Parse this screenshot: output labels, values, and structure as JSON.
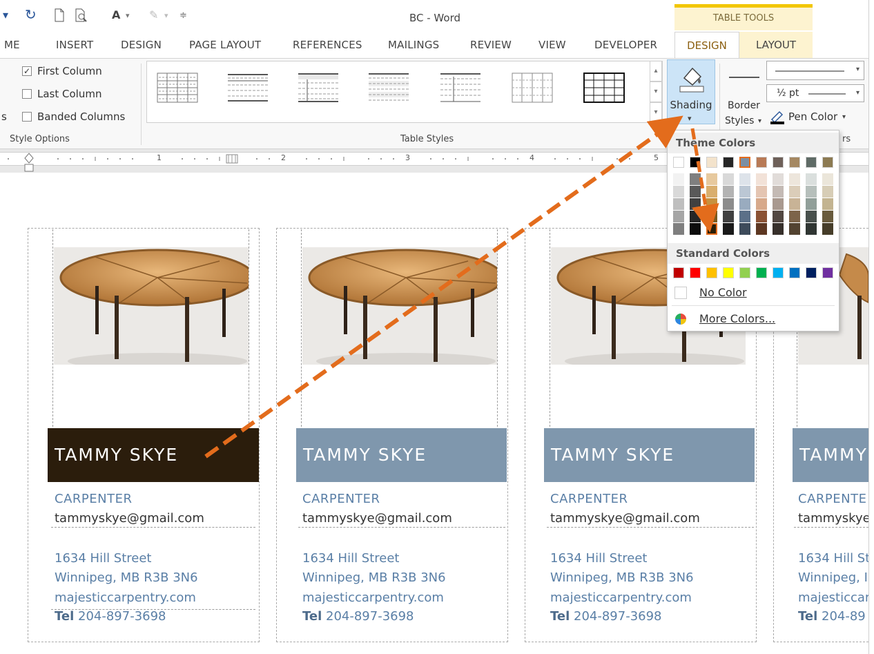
{
  "window": {
    "title": "BC - Word",
    "contextual_group": "TABLE TOOLS"
  },
  "tabs": [
    "ME",
    "INSERT",
    "DESIGN",
    "PAGE LAYOUT",
    "REFERENCES",
    "MAILINGS",
    "REVIEW",
    "VIEW",
    "DEVELOPER"
  ],
  "contextual_tabs": {
    "design": "DESIGN",
    "layout": "LAYOUT"
  },
  "style_options": {
    "first_column": "First Column",
    "last_column": "Last Column",
    "banded_columns": "Banded Columns",
    "group_label": "Style Options",
    "left_fragment": "s"
  },
  "table_styles": {
    "group_label": "Table Styles"
  },
  "shading": {
    "label": "Shading"
  },
  "borders": {
    "border_styles_line1": "Border",
    "border_styles_line2": "Styles",
    "pen_weight": "½ pt",
    "pen_color": "Pen Color",
    "group_fragment": "rs"
  },
  "ruler": {
    "numbers": [
      "1",
      "2",
      "3",
      "4",
      "5"
    ]
  },
  "shading_menu": {
    "theme_header": "Theme Colors",
    "standard_header": "Standard Colors",
    "no_color": "No Color",
    "more_colors": "More Colors...",
    "theme_top_row": [
      "#ffffff",
      "#000000",
      "#f3e3cc",
      "#262626",
      "#7b8fa3",
      "#b87a56",
      "#6e6059",
      "#a58862",
      "#5f6b66",
      "#8c7a52"
    ],
    "theme_tints": [
      [
        "#f2f2f2",
        "#7f7f7f",
        "#e7c99e",
        "#d9d9d9",
        "#dde3ea",
        "#f2e2d8",
        "#e1dcd9",
        "#ede6dc",
        "#dadfdd",
        "#ebe6da"
      ],
      [
        "#d9d9d9",
        "#595959",
        "#d9ae6d",
        "#b3b3b3",
        "#bbc7d4",
        "#e4c5b2",
        "#c4bab4",
        "#dbcdb9",
        "#b6bfbb",
        "#d7cdb6"
      ],
      [
        "#bfbfbf",
        "#404040",
        "#c7913f",
        "#8c8c8c",
        "#99abbf",
        "#d7a98b",
        "#a9998f",
        "#c8b396",
        "#919f99",
        "#c3b491"
      ],
      [
        "#a6a6a6",
        "#262626",
        "#7c5a1d",
        "#404040",
        "#5c7088",
        "#8b5234",
        "#524741",
        "#7c644a",
        "#48504c",
        "#695b3d"
      ],
      [
        "#7f7f7f",
        "#0d0d0d",
        "#2a1e08",
        "#1a1a1a",
        "#3d4b5b",
        "#5d3722",
        "#37302b",
        "#534331",
        "#303633",
        "#463d29"
      ]
    ],
    "standard": [
      "#c00000",
      "#ff0000",
      "#ffc000",
      "#ffff00",
      "#92d050",
      "#00b050",
      "#00b0f0",
      "#0070c0",
      "#002060",
      "#7030a0"
    ]
  },
  "cards": [
    {
      "name": "TAMMY SKYE",
      "role": "CARPENTER",
      "email": "tammyskye@gmail.com",
      "street": "1634 Hill Street",
      "city": "Winnipeg, MB R3B 3N6",
      "web": "majesticcarpentry.com",
      "tel_label": "Tel",
      "tel": "204-897-3698",
      "bar_color": "#2b1d0c"
    },
    {
      "name": "TAMMY SKYE",
      "role": "CARPENTER",
      "email": "tammyskye@gmail.com",
      "street": "1634 Hill Street",
      "city": "Winnipeg, MB R3B 3N6",
      "web": "majesticcarpentry.com",
      "tel_label": "Tel",
      "tel": "204-897-3698",
      "bar_color": "#7f97ad"
    },
    {
      "name": "TAMMY SKYE",
      "role": "CARPENTER",
      "email": "tammyskye@gmail.com",
      "street": "1634 Hill Street",
      "city": "Winnipeg, MB R3B 3N6",
      "web": "majesticcarpentry.com",
      "tel_label": "Tel",
      "tel": "204-897-3698",
      "bar_color": "#7f97ad"
    },
    {
      "name": "TAMMY",
      "role": "CARPENTE",
      "email": "tammyskye",
      "street": "1634 Hill St",
      "city": "Winnipeg, I",
      "web": "majesticcar",
      "tel_label": "Tel",
      "tel": "204-89",
      "bar_color": "#7f97ad"
    }
  ],
  "annotation_color": "#e36c1c"
}
